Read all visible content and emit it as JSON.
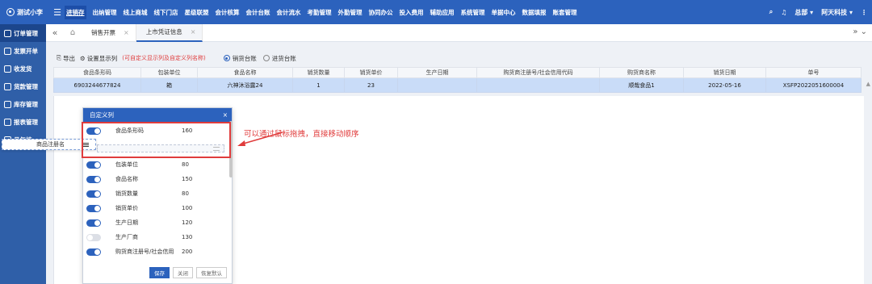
{
  "brand": {
    "name": "测试小李"
  },
  "nav": [
    "进销存",
    "出纳管理",
    "线上商城",
    "线下门店",
    "星级联盟",
    "会计核算",
    "会计台账",
    "会计流水",
    "考勤管理",
    "外勤管理",
    "协同办公",
    "投入费用",
    "辅助应用",
    "系统管理",
    "单据中心",
    "数据填报",
    "账套管理"
  ],
  "nav_active": 0,
  "top_right": {
    "company": "总部 ▾",
    "account": "阿天科技 ▾"
  },
  "sidebar": [
    "订单管理",
    "发票开单",
    "收发货",
    "货款管理",
    "库存管理",
    "报表管理",
    "月年结"
  ],
  "sidebar_active": 0,
  "tabs": [
    "销售开票",
    "上市凭证信息"
  ],
  "tab_active": 1,
  "toolbar": {
    "export": "导出",
    "settings": "设置显示列",
    "hint": "(可自定义显示列及自定义列名称)",
    "radio1": "销货台账",
    "radio2": "进货台账"
  },
  "grid": {
    "columns": [
      "食品条形码",
      "包装单位",
      "食品名称",
      "销货数量",
      "销货单价",
      "生产日期",
      "购货商注册号/社会信用代码",
      "购货商名称",
      "销货日期",
      "单号"
    ],
    "rows": [
      [
        "6903244677824",
        "箱",
        "六神沐浴露24",
        "1",
        "23",
        "",
        "",
        "顺哉食品1",
        "2022-05-16",
        "XSFP2022051600004"
      ]
    ]
  },
  "annotation": "可以通过鼠标拖拽，直接移动顺序",
  "panel": {
    "title": "自定义列",
    "close": "×",
    "drag_item": "商品注册名",
    "rows": [
      {
        "name": "食品条形码",
        "width": "160",
        "on": true
      },
      {
        "name": "包装单位",
        "width": "80",
        "on": true
      },
      {
        "name": "食品名称",
        "width": "150",
        "on": true
      },
      {
        "name": "销货数量",
        "width": "80",
        "on": true
      },
      {
        "name": "销货单价",
        "width": "100",
        "on": true
      },
      {
        "name": "生产日期",
        "width": "120",
        "on": true
      },
      {
        "name": "生产厂商",
        "width": "130",
        "on": false
      },
      {
        "name": "购货商注册号/社会信用",
        "width": "200",
        "on": true
      }
    ],
    "buttons": {
      "save": "保存",
      "close": "关闭",
      "reset": "恢复默认"
    }
  }
}
